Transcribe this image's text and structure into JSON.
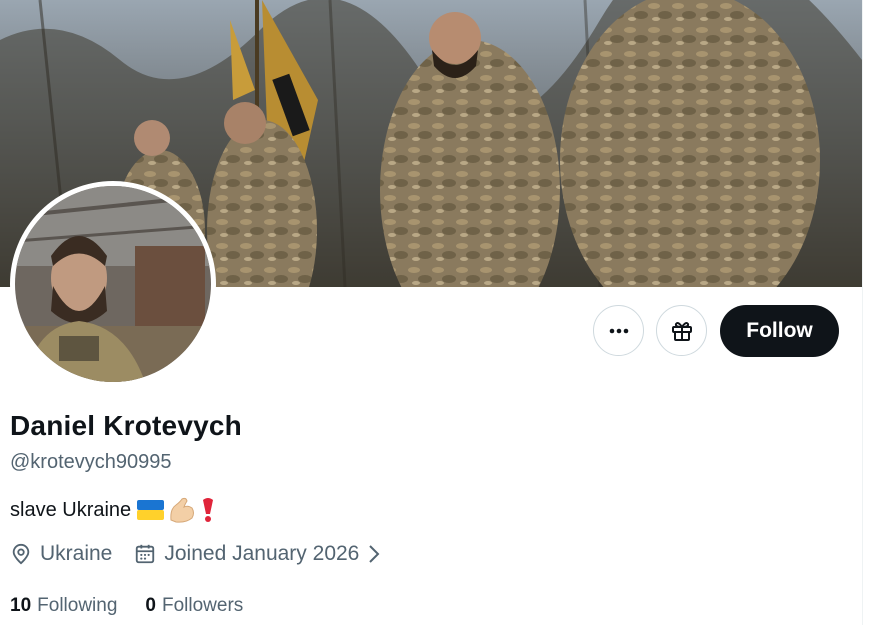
{
  "profile": {
    "display_name": "Daniel Krotevych",
    "handle": "@krotevych90995",
    "bio": "slave Ukraine",
    "bio_emojis": [
      "ukraine-flag-icon",
      "flexed-biceps-icon",
      "heavy-exclamation-icon"
    ],
    "location": "Ukraine",
    "joined": "Joined January 2026",
    "following_count": "10",
    "following_label": "Following",
    "followers_count": "0",
    "followers_label": "Followers"
  },
  "actions": {
    "more_icon": "ellipsis-icon",
    "gift_icon": "gift-icon",
    "follow_label": "Follow"
  },
  "colors": {
    "text_primary": "#0f1419",
    "text_secondary": "#536471",
    "button_dark": "#0f1419",
    "border": "#cfd9de"
  }
}
